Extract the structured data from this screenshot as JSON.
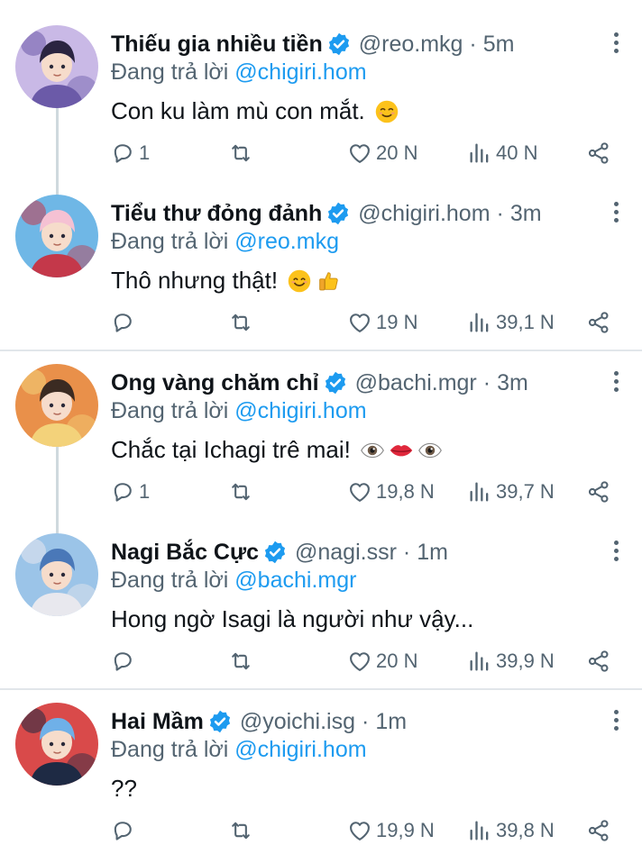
{
  "tweets": [
    {
      "name": "Thiếu gia nhiều tiền",
      "handle": "@reo.mkg",
      "dot": "·",
      "time": "5m",
      "replying_prefix": "Đang trả lời",
      "replying_to": "@chigiri.hom",
      "text": "Con ku làm mù con mắt.",
      "emojis": [
        "relieved-face"
      ],
      "replies": "1",
      "likes": "20 N",
      "views": "40 N",
      "avatar_colors": [
        "#6b5aa8",
        "#2a2440",
        "#c9b9e6"
      ]
    },
    {
      "name": "Tiểu thư đỏng đảnh",
      "handle": "@chigiri.hom",
      "dot": "·",
      "time": "3m",
      "replying_prefix": "Đang trả lời",
      "replying_to": "@reo.mkg",
      "text": "Thô nhưng thật!",
      "emojis": [
        "smiling-face",
        "thumbs-up"
      ],
      "replies": "",
      "likes": "19 N",
      "views": "39,1 N",
      "avatar_colors": [
        "#c4384a",
        "#f5c1d3",
        "#6fb7e6"
      ]
    },
    {
      "name": "Ong vàng chăm chỉ",
      "handle": "@bachi.mgr",
      "dot": "·",
      "time": "3m",
      "replying_prefix": "Đang trả lời",
      "replying_to": "@chigiri.hom",
      "text": "Chắc tại Ichagi trê mai!",
      "emojis": [
        "eye",
        "lips",
        "eye"
      ],
      "replies": "1",
      "likes": "19,8 N",
      "views": "39,7 N",
      "avatar_colors": [
        "#f3d27a",
        "#3b2b22",
        "#e9904a"
      ]
    },
    {
      "name": "Nagi Bắc Cực",
      "handle": "@nagi.ssr",
      "dot": "·",
      "time": "1m",
      "replying_prefix": "Đang trả lời",
      "replying_to": "@bachi.mgr",
      "text": "Hong ngờ Isagi là người như vậy...",
      "emojis": [],
      "replies": "",
      "likes": "20 N",
      "views": "39,9 N",
      "avatar_colors": [
        "#e8e8ee",
        "#4a78b8",
        "#9bc4e8"
      ]
    },
    {
      "name": "Hai Mầm",
      "handle": "@yoichi.isg",
      "dot": "·",
      "time": "1m",
      "replying_prefix": "Đang trả lời",
      "replying_to": "@chigiri.hom",
      "text": "??",
      "emojis": [],
      "replies": "",
      "likes": "19,9 N",
      "views": "39,8 N",
      "avatar_colors": [
        "#1e2a44",
        "#6fb0e8",
        "#d94a4a"
      ]
    }
  ],
  "icons": {
    "reply": "reply-icon",
    "retweet": "retweet-icon",
    "like": "heart-icon",
    "views": "views-icon",
    "share": "share-icon",
    "more": "more-icon",
    "verified": "verified-badge-icon"
  },
  "colors": {
    "accent": "#1d9bf0",
    "secondary_text": "#536471",
    "primary_text": "#0f1419"
  }
}
